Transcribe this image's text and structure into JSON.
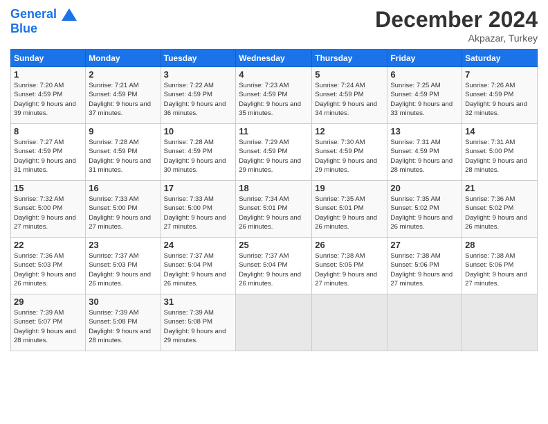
{
  "header": {
    "logo_line1": "General",
    "logo_line2": "Blue",
    "month_title": "December 2024",
    "subtitle": "Akpazar, Turkey"
  },
  "weekdays": [
    "Sunday",
    "Monday",
    "Tuesday",
    "Wednesday",
    "Thursday",
    "Friday",
    "Saturday"
  ],
  "weeks": [
    [
      {
        "day": "1",
        "sunrise": "7:20 AM",
        "sunset": "4:59 PM",
        "daylight": "9 hours and 39 minutes."
      },
      {
        "day": "2",
        "sunrise": "7:21 AM",
        "sunset": "4:59 PM",
        "daylight": "9 hours and 37 minutes."
      },
      {
        "day": "3",
        "sunrise": "7:22 AM",
        "sunset": "4:59 PM",
        "daylight": "9 hours and 36 minutes."
      },
      {
        "day": "4",
        "sunrise": "7:23 AM",
        "sunset": "4:59 PM",
        "daylight": "9 hours and 35 minutes."
      },
      {
        "day": "5",
        "sunrise": "7:24 AM",
        "sunset": "4:59 PM",
        "daylight": "9 hours and 34 minutes."
      },
      {
        "day": "6",
        "sunrise": "7:25 AM",
        "sunset": "4:59 PM",
        "daylight": "9 hours and 33 minutes."
      },
      {
        "day": "7",
        "sunrise": "7:26 AM",
        "sunset": "4:59 PM",
        "daylight": "9 hours and 32 minutes."
      }
    ],
    [
      {
        "day": "8",
        "sunrise": "7:27 AM",
        "sunset": "4:59 PM",
        "daylight": "9 hours and 31 minutes."
      },
      {
        "day": "9",
        "sunrise": "7:28 AM",
        "sunset": "4:59 PM",
        "daylight": "9 hours and 31 minutes."
      },
      {
        "day": "10",
        "sunrise": "7:28 AM",
        "sunset": "4:59 PM",
        "daylight": "9 hours and 30 minutes."
      },
      {
        "day": "11",
        "sunrise": "7:29 AM",
        "sunset": "4:59 PM",
        "daylight": "9 hours and 29 minutes."
      },
      {
        "day": "12",
        "sunrise": "7:30 AM",
        "sunset": "4:59 PM",
        "daylight": "9 hours and 29 minutes."
      },
      {
        "day": "13",
        "sunrise": "7:31 AM",
        "sunset": "4:59 PM",
        "daylight": "9 hours and 28 minutes."
      },
      {
        "day": "14",
        "sunrise": "7:31 AM",
        "sunset": "5:00 PM",
        "daylight": "9 hours and 28 minutes."
      }
    ],
    [
      {
        "day": "15",
        "sunrise": "7:32 AM",
        "sunset": "5:00 PM",
        "daylight": "9 hours and 27 minutes."
      },
      {
        "day": "16",
        "sunrise": "7:33 AM",
        "sunset": "5:00 PM",
        "daylight": "9 hours and 27 minutes."
      },
      {
        "day": "17",
        "sunrise": "7:33 AM",
        "sunset": "5:00 PM",
        "daylight": "9 hours and 27 minutes."
      },
      {
        "day": "18",
        "sunrise": "7:34 AM",
        "sunset": "5:01 PM",
        "daylight": "9 hours and 26 minutes."
      },
      {
        "day": "19",
        "sunrise": "7:35 AM",
        "sunset": "5:01 PM",
        "daylight": "9 hours and 26 minutes."
      },
      {
        "day": "20",
        "sunrise": "7:35 AM",
        "sunset": "5:02 PM",
        "daylight": "9 hours and 26 minutes."
      },
      {
        "day": "21",
        "sunrise": "7:36 AM",
        "sunset": "5:02 PM",
        "daylight": "9 hours and 26 minutes."
      }
    ],
    [
      {
        "day": "22",
        "sunrise": "7:36 AM",
        "sunset": "5:03 PM",
        "daylight": "9 hours and 26 minutes."
      },
      {
        "day": "23",
        "sunrise": "7:37 AM",
        "sunset": "5:03 PM",
        "daylight": "9 hours and 26 minutes."
      },
      {
        "day": "24",
        "sunrise": "7:37 AM",
        "sunset": "5:04 PM",
        "daylight": "9 hours and 26 minutes."
      },
      {
        "day": "25",
        "sunrise": "7:37 AM",
        "sunset": "5:04 PM",
        "daylight": "9 hours and 26 minutes."
      },
      {
        "day": "26",
        "sunrise": "7:38 AM",
        "sunset": "5:05 PM",
        "daylight": "9 hours and 27 minutes."
      },
      {
        "day": "27",
        "sunrise": "7:38 AM",
        "sunset": "5:06 PM",
        "daylight": "9 hours and 27 minutes."
      },
      {
        "day": "28",
        "sunrise": "7:38 AM",
        "sunset": "5:06 PM",
        "daylight": "9 hours and 27 minutes."
      }
    ],
    [
      {
        "day": "29",
        "sunrise": "7:39 AM",
        "sunset": "5:07 PM",
        "daylight": "9 hours and 28 minutes."
      },
      {
        "day": "30",
        "sunrise": "7:39 AM",
        "sunset": "5:08 PM",
        "daylight": "9 hours and 28 minutes."
      },
      {
        "day": "31",
        "sunrise": "7:39 AM",
        "sunset": "5:08 PM",
        "daylight": "9 hours and 29 minutes."
      },
      null,
      null,
      null,
      null
    ]
  ]
}
